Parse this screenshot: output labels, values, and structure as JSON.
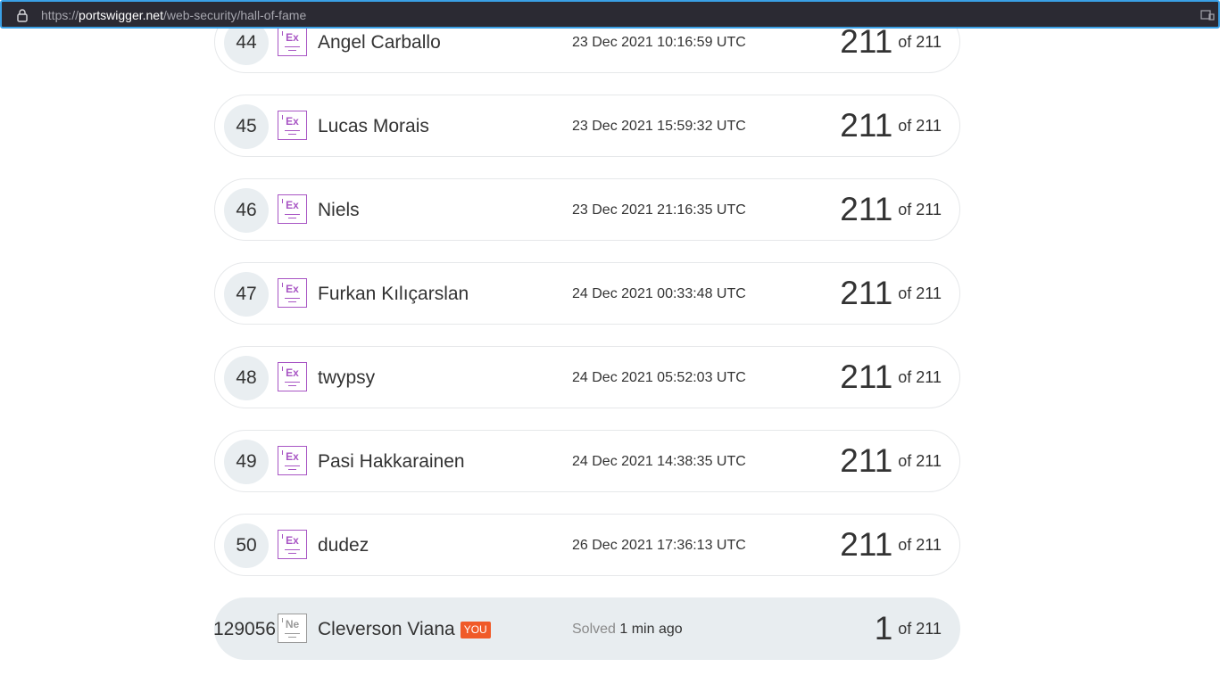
{
  "browser": {
    "url_prefix": "https://",
    "url_host": "portswigger.net",
    "url_path": "/web-security/hall-of-fame",
    "lock_icon": "lock-icon",
    "reader_icon": "reader-view-icon"
  },
  "colors": {
    "expert_badge": "#a855c4",
    "novice_badge": "#9a9a9a",
    "you_tag": "#f05a28",
    "address_bar_border": "#3aa0e6"
  },
  "rows": [
    {
      "rank": "44",
      "level": "Ex",
      "name": "Angel Carballo",
      "date": "23 Dec 2021 10:16:59 UTC",
      "score": "211",
      "of_label": "of 211"
    },
    {
      "rank": "45",
      "level": "Ex",
      "name": "Lucas Morais",
      "date": "23 Dec 2021 15:59:32 UTC",
      "score": "211",
      "of_label": "of 211"
    },
    {
      "rank": "46",
      "level": "Ex",
      "name": "Niels",
      "date": "23 Dec 2021 21:16:35 UTC",
      "score": "211",
      "of_label": "of 211"
    },
    {
      "rank": "47",
      "level": "Ex",
      "name": "Furkan Kılıçarslan",
      "date": "24 Dec 2021 00:33:48 UTC",
      "score": "211",
      "of_label": "of 211"
    },
    {
      "rank": "48",
      "level": "Ex",
      "name": "twypsy",
      "date": "24 Dec 2021 05:52:03 UTC",
      "score": "211",
      "of_label": "of 211"
    },
    {
      "rank": "49",
      "level": "Ex",
      "name": "Pasi Hakkarainen",
      "date": "24 Dec 2021 14:38:35 UTC",
      "score": "211",
      "of_label": "of 211"
    },
    {
      "rank": "50",
      "level": "Ex",
      "name": "dudez",
      "date": "26 Dec 2021 17:36:13 UTC",
      "score": "211",
      "of_label": "of 211"
    }
  ],
  "you_row": {
    "rank": "129056",
    "level": "Ne",
    "name": "Cleverson Viana",
    "you_label": "YOU",
    "solved_label": "Solved",
    "solved_when": "1 min ago",
    "score": "1",
    "of_label": "of 211"
  }
}
